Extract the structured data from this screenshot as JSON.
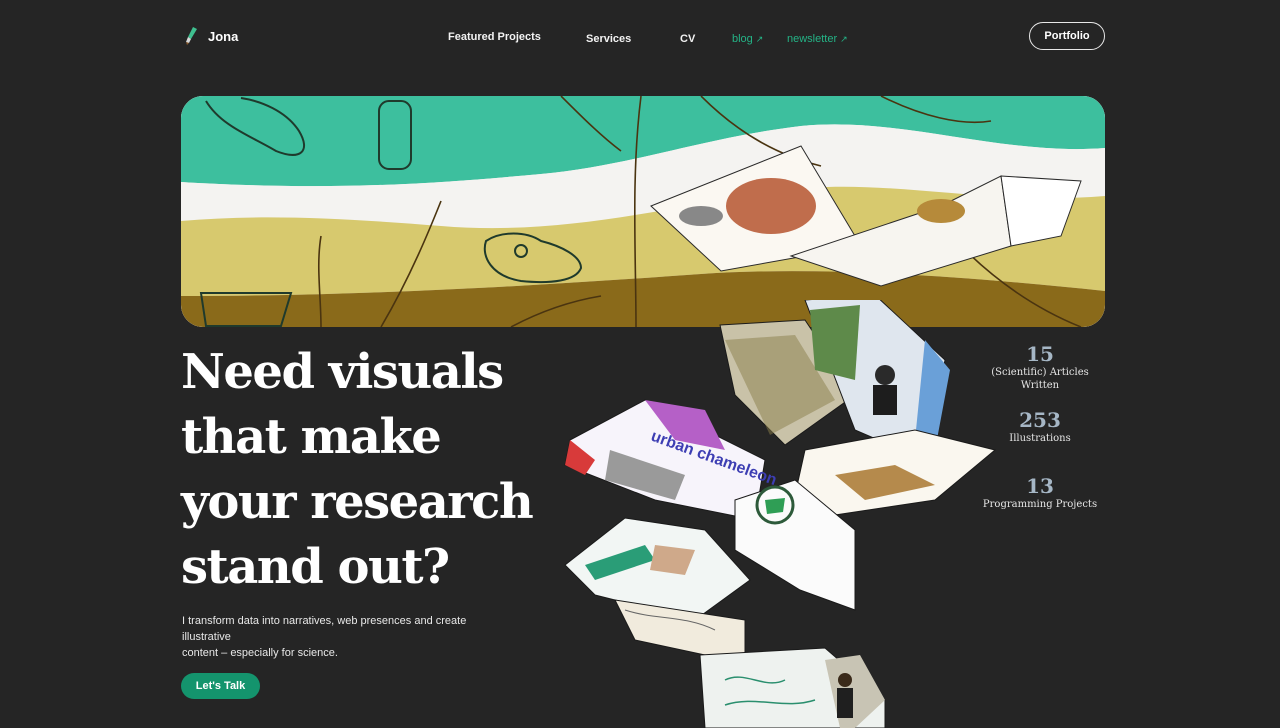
{
  "brand": {
    "name": "Jona",
    "logo_icon": "brush-icon"
  },
  "nav": {
    "featured": "Featured Projects",
    "services": "Services",
    "cv": "CV",
    "blog": "blog",
    "newsletter": "newsletter",
    "external_icon": "external-link-icon",
    "portfolio": "Portfolio"
  },
  "hero": {
    "headline_lines": [
      "Need visuals",
      "that make",
      "your research",
      "stand out?"
    ],
    "subtext_line1": "I transform data into narratives, web presences and create illustrative",
    "subtext_line2": "content – especially for science.",
    "cta": "Let's Talk"
  },
  "stats": [
    {
      "value": "15",
      "label": "(Scientific) Articles Written"
    },
    {
      "value": "253",
      "label": "Illustrations"
    },
    {
      "value": "13",
      "label": "Programming Projects"
    }
  ],
  "collage_text": {
    "card_title": "urban chameleon"
  },
  "colors": {
    "background": "#252525",
    "accent_green": "#14946d",
    "link_green": "#24b386",
    "banner_teal": "#3dbf9e",
    "banner_yellow": "#d7c96e",
    "banner_brown": "#8a6a1a",
    "stat_number": "#a6b7c6"
  }
}
